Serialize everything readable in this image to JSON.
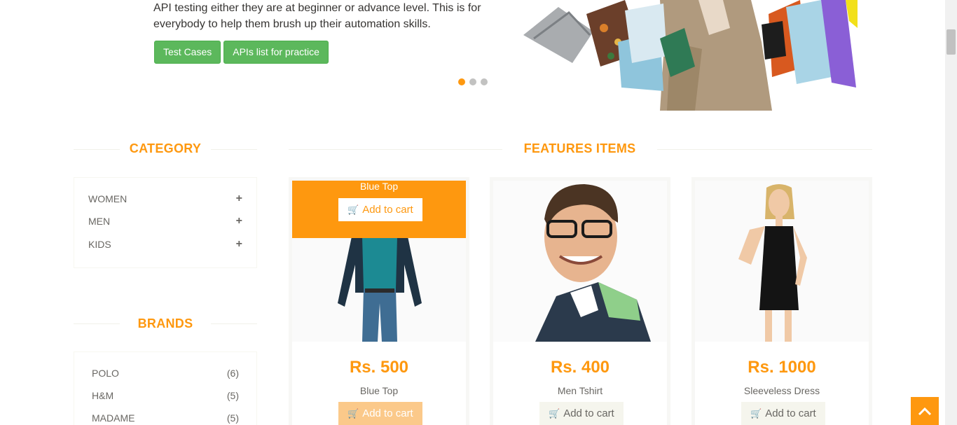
{
  "hero": {
    "text_line1": "API testing either they are at beginner or advance level. This is for",
    "text_line2": "everybody to help them brush up their automation skills.",
    "btn_test_cases": "Test Cases",
    "btn_apis_list": "APIs list for practice"
  },
  "sidebar": {
    "category_title": "CATEGORY",
    "categories": [
      {
        "label": "WOMEN"
      },
      {
        "label": "MEN"
      },
      {
        "label": "KIDS"
      }
    ],
    "brands_title": "BRANDS",
    "brands": [
      {
        "label": "POLO",
        "count": "(6)"
      },
      {
        "label": "H&M",
        "count": "(5)"
      },
      {
        "label": "MADAME",
        "count": "(5)"
      }
    ]
  },
  "features": {
    "title": "FEATURES ITEMS",
    "add_to_cart": "Add to cart",
    "products": [
      {
        "name": "Blue Top",
        "price": "Rs. 500"
      },
      {
        "name": "Men Tshirt",
        "price": "Rs. 400"
      },
      {
        "name": "Sleeveless Dress",
        "price": "Rs. 1000"
      }
    ]
  },
  "colors": {
    "accent": "#fe980f",
    "green": "#5cb85c"
  }
}
